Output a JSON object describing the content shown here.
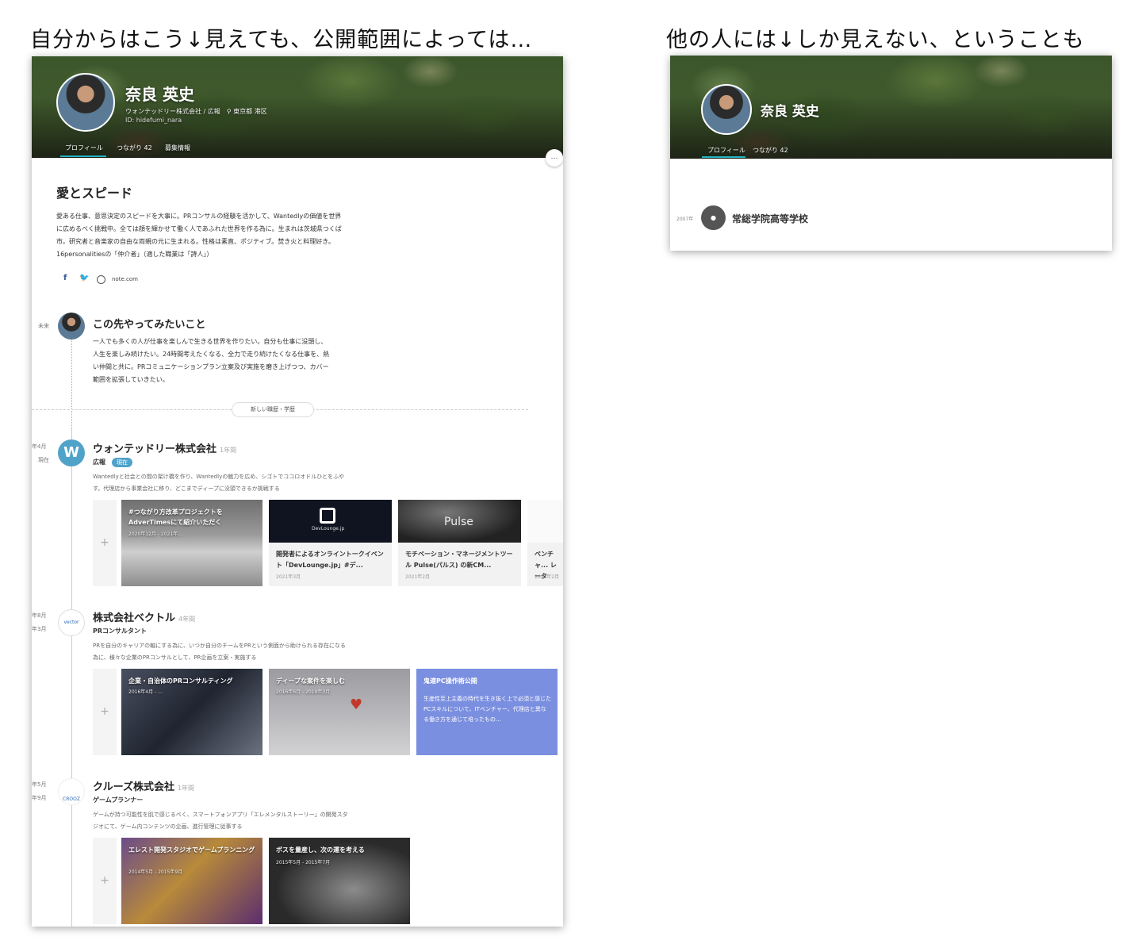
{
  "captions": {
    "left": "自分からはこう↓見えても、公開範囲によっては…",
    "right": "他の人には↓しか見えない、ということも"
  },
  "own_view": {
    "profile": {
      "name": "奈良 英史",
      "company_location": "ウォンテッドリー株式会社 / 広報　⚲ 東京都 港区",
      "user_id": "ID: hidefumi_nara",
      "tabs": [
        "プロフィール",
        "つながり 42",
        "募集情報"
      ]
    },
    "more_button": "…",
    "about": {
      "title": "愛とスピード",
      "text": "愛ある仕事、意思決定のスピードを大事に。PRコンサルの経験を活かして、Wantedlyの価値を世界に広めるべく挑戦中。全ては顔を輝かせて働く人であふれた世界を作る為に。生まれは茨城県つくば市。研究者と音楽家の自由な両親の元に生まれる。性格は素直、ポジティブ。焚き火と料理好き。16personalitiesの「仲介者」（適した職業は「詩人」）",
      "social": {
        "facebook": "f",
        "twitter": "🐦",
        "link": "note.com"
      }
    },
    "future": {
      "label": "未来",
      "title": "この先やってみたいこと",
      "text": "一人でも多くの人が仕事を楽しんで生きる世界を作りたい。自分も仕事に没頭し、人生を楽しみ続けたい。24時間考えたくなる、全力で走り続けたくなる仕事を、熱い仲間と共に。PRコミュニケーションプラン立案及び実施を磨き上げつつ、カバー範囲を拡張していきたい。"
    },
    "new_entry_button": "新しい職歴・学歴",
    "add_card_symbol": "+",
    "experiences": [
      {
        "date_start": "年4月",
        "date_end": "現在",
        "icon": "W",
        "company": "ウォンテッドリー株式会社",
        "duration": "1年間",
        "role": "広報",
        "badge": "現在",
        "description": "Wantedlyと社会との間の架け橋を作り、Wantedlyの魅力を広め、シゴトでココロオドルひとをふやす。代理店から事業会社に移り、どこまでディープに没頭できるか挑戦する",
        "cards": [
          {
            "title": "#つながり方改革プロジェクトをAdverTimesにて紹介いただく",
            "date": "2020年12月 - 2021年..."
          },
          {
            "title": "開発者によるオンライントークイベント「DevLounge.jp」#デ...",
            "date": "2021年3月",
            "logo_text": "DevLounge.jp"
          },
          {
            "title": "モチベーション・マネージメントツール Pulse(パルス) の新CM...",
            "date": "2021年2月",
            "logo_text": "Pulse"
          },
          {
            "title": "ベンチャ... レーター...",
            "date": "2021年2月"
          }
        ]
      },
      {
        "date_start": "年8月",
        "date_end": "年3月",
        "icon": "vector",
        "company": "株式会社ベクトル",
        "duration": "4年間",
        "role": "PRコンサルタント",
        "description": "PRを自分のキャリアの軸にする為に、いつか自分のチームをPRという側面から助けられる存在になる為に、様々な企業のPRコンサルとして、PR企画を立案・実施する",
        "cards": [
          {
            "title": "企業・自治体のPRコンサルティング",
            "date": "2016年4月 - ..."
          },
          {
            "title": "ディープな案件を楽しむ",
            "date": "2016年6月 - 2019年3月"
          },
          {
            "title": "鬼速PC操作術公開",
            "description": "生産性至上主義の時代を生き抜く上で必須と感じたPCスキルについて、ITベンチャー、代理店と異なる働き方を通じて培ったもの..."
          }
        ]
      },
      {
        "date_start": "年5月",
        "date_end": "年9月",
        "icon": "CROOZ",
        "company": "クルーズ株式会社",
        "duration": "1年間",
        "role": "ゲームプランナー",
        "description": "ゲームが持つ可能性を肌で感じるべく、スマートフォンアプリ「エレメンタルストーリー」の開発スタジオにて、ゲーム内コンテンツの企画、進行管理に従事する",
        "cards": [
          {
            "title": "エレスト開発スタジオでゲームプランニング",
            "date": "2014年5月 - 2015年9月"
          },
          {
            "title": "ボスを量産し、次の運を考える",
            "date": "2015年5月 - 2015年7月"
          }
        ]
      }
    ]
  },
  "public_view": {
    "profile": {
      "name": "奈良 英史",
      "tabs": [
        "プロフィール",
        "つながり 42"
      ]
    },
    "education": {
      "date": "2007年",
      "school": "常総学院高等学校"
    }
  }
}
